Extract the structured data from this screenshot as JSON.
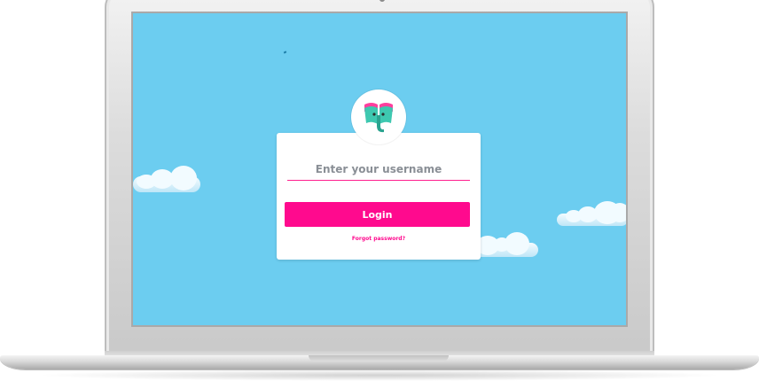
{
  "login": {
    "username_placeholder": "Enter your username",
    "username_value": "",
    "login_label": "Login",
    "forgot_label": "Forgot password?"
  },
  "colors": {
    "sky": "#6ccdf0",
    "accent": "#ff0a8e",
    "logo_teal": "#3ec8b0"
  },
  "icons": {
    "logo": "elephant-book-logo-icon"
  }
}
